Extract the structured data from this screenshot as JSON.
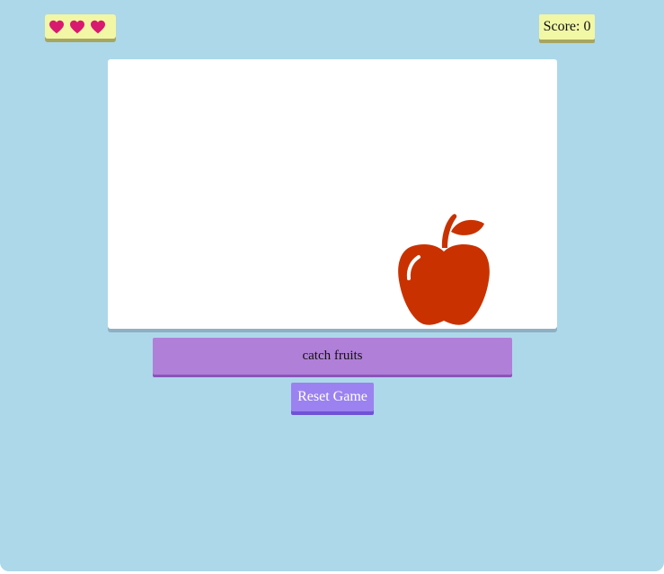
{
  "hud": {
    "lives": 3,
    "score_text": "Score: 0"
  },
  "game": {
    "fruit_icon": "apple-icon"
  },
  "instruction": {
    "text": "catch fruits"
  },
  "controls": {
    "reset_label": "Reset Game"
  },
  "colors": {
    "background": "#add8ea",
    "hud_box": "#f2f7a6",
    "heart": "#d81b6f",
    "apple": "#c93200",
    "instruction_bar": "#b07fd8",
    "reset_button": "#9b82f0"
  }
}
